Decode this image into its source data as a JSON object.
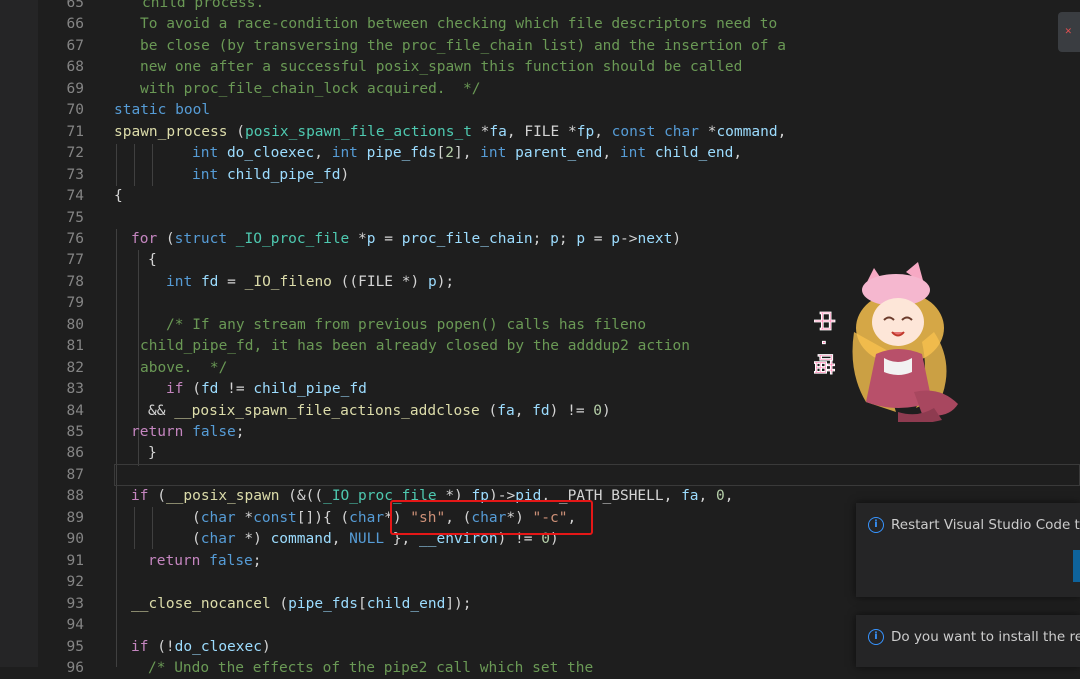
{
  "editor": {
    "lines": [
      {
        "n": "65",
        "indent": 104,
        "tokens": [
          {
            "t": "child process.",
            "c": "cmt"
          }
        ]
      },
      {
        "n": "66",
        "indent": 102,
        "tokens": [
          {
            "t": "To avoid a race-condition between checking which file descriptors need to",
            "c": "cmt"
          }
        ]
      },
      {
        "n": "67",
        "indent": 102,
        "tokens": [
          {
            "t": "be close (by transversing the proc_file_chain list) and the insertion of a",
            "c": "cmt"
          }
        ]
      },
      {
        "n": "68",
        "indent": 102,
        "tokens": [
          {
            "t": "new one after a successful posix_spawn this function should be called",
            "c": "cmt"
          }
        ]
      },
      {
        "n": "69",
        "indent": 102,
        "tokens": [
          {
            "t": "with proc_file_chain_lock acquired.  */",
            "c": "cmt"
          }
        ]
      },
      {
        "n": "70",
        "indent": 76,
        "tokens": [
          {
            "t": "static",
            "c": "kw"
          },
          {
            "t": " ",
            "c": "p"
          },
          {
            "t": "bool",
            "c": "kw"
          }
        ]
      },
      {
        "n": "71",
        "indent": 76,
        "tokens": [
          {
            "t": "spawn_process",
            "c": "fn"
          },
          {
            "t": " (",
            "c": "p"
          },
          {
            "t": "posix_spawn_file_actions_t",
            "c": "type"
          },
          {
            "t": " *",
            "c": "p"
          },
          {
            "t": "fa",
            "c": "var"
          },
          {
            "t": ", FILE *",
            "c": "p"
          },
          {
            "t": "fp",
            "c": "var"
          },
          {
            "t": ", ",
            "c": "p"
          },
          {
            "t": "const",
            "c": "kw"
          },
          {
            "t": " ",
            "c": "p"
          },
          {
            "t": "char",
            "c": "kw"
          },
          {
            "t": " *",
            "c": "p"
          },
          {
            "t": "command",
            "c": "var"
          },
          {
            "t": ",",
            "c": "p"
          }
        ]
      },
      {
        "n": "72",
        "indent": 154,
        "tokens": [
          {
            "t": "int",
            "c": "kw"
          },
          {
            "t": " ",
            "c": "p"
          },
          {
            "t": "do_cloexec",
            "c": "var"
          },
          {
            "t": ", ",
            "c": "p"
          },
          {
            "t": "int",
            "c": "kw"
          },
          {
            "t": " ",
            "c": "p"
          },
          {
            "t": "pipe_fds",
            "c": "var"
          },
          {
            "t": "[",
            "c": "p"
          },
          {
            "t": "2",
            "c": "num"
          },
          {
            "t": "], ",
            "c": "p"
          },
          {
            "t": "int",
            "c": "kw"
          },
          {
            "t": " ",
            "c": "p"
          },
          {
            "t": "parent_end",
            "c": "var"
          },
          {
            "t": ", ",
            "c": "p"
          },
          {
            "t": "int",
            "c": "kw"
          },
          {
            "t": " ",
            "c": "p"
          },
          {
            "t": "child_end",
            "c": "var"
          },
          {
            "t": ",",
            "c": "p"
          }
        ]
      },
      {
        "n": "73",
        "indent": 154,
        "tokens": [
          {
            "t": "int",
            "c": "kw"
          },
          {
            "t": " ",
            "c": "p"
          },
          {
            "t": "child_pipe_fd",
            "c": "var"
          },
          {
            "t": ")",
            "c": "p"
          }
        ]
      },
      {
        "n": "74",
        "indent": 76,
        "tokens": [
          {
            "t": "{",
            "c": "p"
          }
        ]
      },
      {
        "n": "75",
        "indent": 76,
        "tokens": []
      },
      {
        "n": "76",
        "indent": 93,
        "tokens": [
          {
            "t": "for",
            "c": "ctl"
          },
          {
            "t": " (",
            "c": "p"
          },
          {
            "t": "struct",
            "c": "kw"
          },
          {
            "t": " ",
            "c": "p"
          },
          {
            "t": "_IO_proc_file",
            "c": "type"
          },
          {
            "t": " *",
            "c": "p"
          },
          {
            "t": "p",
            "c": "var"
          },
          {
            "t": " = ",
            "c": "p"
          },
          {
            "t": "proc_file_chain",
            "c": "var"
          },
          {
            "t": "; ",
            "c": "p"
          },
          {
            "t": "p",
            "c": "var"
          },
          {
            "t": "; ",
            "c": "p"
          },
          {
            "t": "p",
            "c": "var"
          },
          {
            "t": " = ",
            "c": "p"
          },
          {
            "t": "p",
            "c": "var"
          },
          {
            "t": "->",
            "c": "p"
          },
          {
            "t": "next",
            "c": "var"
          },
          {
            "t": ")",
            "c": "p"
          }
        ]
      },
      {
        "n": "77",
        "indent": 110,
        "tokens": [
          {
            "t": "{",
            "c": "p"
          }
        ]
      },
      {
        "n": "78",
        "indent": 128,
        "tokens": [
          {
            "t": "int",
            "c": "kw"
          },
          {
            "t": " ",
            "c": "p"
          },
          {
            "t": "fd",
            "c": "var"
          },
          {
            "t": " = ",
            "c": "p"
          },
          {
            "t": "_IO_fileno",
            "c": "fn"
          },
          {
            "t": " ((FILE *) ",
            "c": "p"
          },
          {
            "t": "p",
            "c": "var"
          },
          {
            "t": ");",
            "c": "p"
          }
        ]
      },
      {
        "n": "79",
        "indent": 76,
        "tokens": []
      },
      {
        "n": "80",
        "indent": 128,
        "tokens": [
          {
            "t": "/* If any stream from previous popen() calls has fileno",
            "c": "cmt"
          }
        ]
      },
      {
        "n": "81",
        "indent": 102,
        "tokens": [
          {
            "t": "child_pipe_fd, it has been already closed by the adddup2 action",
            "c": "cmt"
          }
        ]
      },
      {
        "n": "82",
        "indent": 102,
        "tokens": [
          {
            "t": "above.  */",
            "c": "cmt"
          }
        ]
      },
      {
        "n": "83",
        "indent": 128,
        "tokens": [
          {
            "t": "if",
            "c": "ctl"
          },
          {
            "t": " (",
            "c": "p"
          },
          {
            "t": "fd",
            "c": "var"
          },
          {
            "t": " != ",
            "c": "p"
          },
          {
            "t": "child_pipe_fd",
            "c": "var"
          }
        ]
      },
      {
        "n": "84",
        "indent": 110,
        "tokens": [
          {
            "t": "&& ",
            "c": "p"
          },
          {
            "t": "__posix_spawn_file_actions_addclose",
            "c": "fn"
          },
          {
            "t": " (",
            "c": "p"
          },
          {
            "t": "fa",
            "c": "var"
          },
          {
            "t": ", ",
            "c": "p"
          },
          {
            "t": "fd",
            "c": "var"
          },
          {
            "t": ") != ",
            "c": "p"
          },
          {
            "t": "0",
            "c": "num"
          },
          {
            "t": ")",
            "c": "p"
          }
        ]
      },
      {
        "n": "85",
        "indent": 93,
        "tokens": [
          {
            "t": "return",
            "c": "ctl"
          },
          {
            "t": " ",
            "c": "p"
          },
          {
            "t": "false",
            "c": "kw"
          },
          {
            "t": ";",
            "c": "p"
          }
        ]
      },
      {
        "n": "86",
        "indent": 110,
        "tokens": [
          {
            "t": "}",
            "c": "p"
          }
        ]
      },
      {
        "n": "87",
        "indent": 76,
        "tokens": []
      },
      {
        "n": "88",
        "indent": 93,
        "tokens": [
          {
            "t": "if",
            "c": "ctl"
          },
          {
            "t": " (",
            "c": "p"
          },
          {
            "t": "__posix_spawn",
            "c": "fn"
          },
          {
            "t": " (&((",
            "c": "p"
          },
          {
            "t": "_IO_proc_file",
            "c": "type"
          },
          {
            "t": " *) ",
            "c": "p"
          },
          {
            "t": "fp",
            "c": "var"
          },
          {
            "t": ")->",
            "c": "p"
          },
          {
            "t": "pid",
            "c": "var"
          },
          {
            "t": ", _PATH_BSHELL, ",
            "c": "p"
          },
          {
            "t": "fa",
            "c": "var"
          },
          {
            "t": ", ",
            "c": "p"
          },
          {
            "t": "0",
            "c": "num"
          },
          {
            "t": ",",
            "c": "p"
          }
        ]
      },
      {
        "n": "89",
        "indent": 154,
        "tokens": [
          {
            "t": "(",
            "c": "p"
          },
          {
            "t": "char",
            "c": "kw"
          },
          {
            "t": " *",
            "c": "p"
          },
          {
            "t": "const",
            "c": "kw"
          },
          {
            "t": "[]){ (",
            "c": "p"
          },
          {
            "t": "char",
            "c": "kw"
          },
          {
            "t": "*) ",
            "c": "p"
          },
          {
            "t": "\"sh\"",
            "c": "str"
          },
          {
            "t": ", (",
            "c": "p"
          },
          {
            "t": "char",
            "c": "kw"
          },
          {
            "t": "*) ",
            "c": "p"
          },
          {
            "t": "\"-c\"",
            "c": "str"
          },
          {
            "t": ",",
            "c": "p"
          }
        ]
      },
      {
        "n": "90",
        "indent": 154,
        "tokens": [
          {
            "t": "(",
            "c": "p"
          },
          {
            "t": "char",
            "c": "kw"
          },
          {
            "t": " *) ",
            "c": "p"
          },
          {
            "t": "command",
            "c": "var"
          },
          {
            "t": ", ",
            "c": "p"
          },
          {
            "t": "NULL",
            "c": "kw"
          },
          {
            "t": " }, ",
            "c": "p"
          },
          {
            "t": "__environ",
            "c": "var"
          },
          {
            "t": ") != ",
            "c": "p"
          },
          {
            "t": "0",
            "c": "num"
          },
          {
            "t": ")",
            "c": "p"
          }
        ]
      },
      {
        "n": "91",
        "indent": 110,
        "tokens": [
          {
            "t": "return",
            "c": "ctl"
          },
          {
            "t": " ",
            "c": "p"
          },
          {
            "t": "false",
            "c": "kw"
          },
          {
            "t": ";",
            "c": "p"
          }
        ]
      },
      {
        "n": "92",
        "indent": 76,
        "tokens": []
      },
      {
        "n": "93",
        "indent": 93,
        "tokens": [
          {
            "t": "__close_nocancel",
            "c": "fn"
          },
          {
            "t": " (",
            "c": "p"
          },
          {
            "t": "pipe_fds",
            "c": "var"
          },
          {
            "t": "[",
            "c": "p"
          },
          {
            "t": "child_end",
            "c": "var"
          },
          {
            "t": "]);",
            "c": "p"
          }
        ]
      },
      {
        "n": "94",
        "indent": 76,
        "tokens": []
      },
      {
        "n": "95",
        "indent": 93,
        "tokens": [
          {
            "t": "if",
            "c": "ctl"
          },
          {
            "t": " (!",
            "c": "p"
          },
          {
            "t": "do_cloexec",
            "c": "var"
          },
          {
            "t": ")",
            "c": "p"
          }
        ]
      },
      {
        "n": "96",
        "indent": 110,
        "tokens": [
          {
            "t": "/* Undo the effects of the pipe2 call which set the",
            "c": "cmt"
          }
        ]
      }
    ]
  },
  "sticker": {
    "text": "中 · 喵"
  },
  "notifications": [
    {
      "message": "Restart Visual Studio Code to"
    },
    {
      "message": "Do you want to install the rec"
    }
  ],
  "colors": {
    "background": "#1e1e1e",
    "comment": "#6a9955",
    "keyword": "#569cd6",
    "control": "#c586c0",
    "function": "#dcdcaa",
    "variable": "#9cdcfe",
    "string": "#ce9178",
    "number": "#b5cea8",
    "type": "#4ec9b0",
    "annotation": "#e51717",
    "info": "#3794ff"
  }
}
